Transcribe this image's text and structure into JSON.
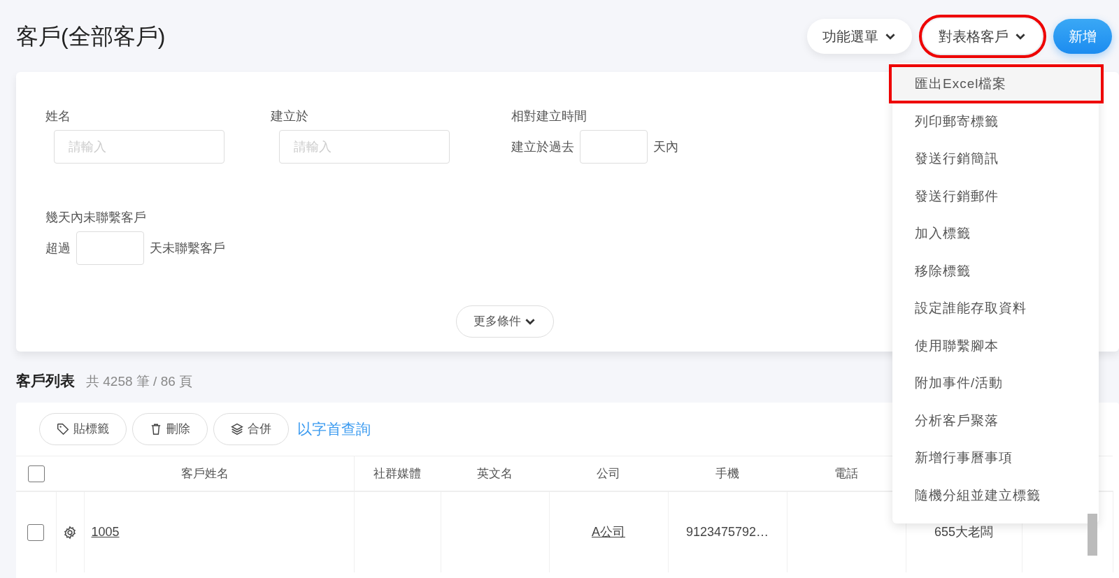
{
  "page_title": "客戶(全部客戶)",
  "header_buttons": [
    {
      "label": "功能選單",
      "kind": "dropdown",
      "highlighted": false
    },
    {
      "label": "對表格客戶",
      "kind": "dropdown",
      "highlighted": true
    },
    {
      "label": "新增",
      "kind": "primary",
      "highlighted": false
    }
  ],
  "filters": {
    "fields": [
      {
        "label": "姓名",
        "kind": "text",
        "placeholder": "請輸入"
      },
      {
        "label": "建立於",
        "kind": "text",
        "placeholder": "請輸入"
      },
      {
        "label": "相對建立時間",
        "kind": "days",
        "prefix": "建立於過去",
        "suffix": "天內"
      },
      {
        "label": "幾天內未聯繫客戶",
        "kind": "days",
        "prefix": "超過",
        "suffix": "天未聯繫客戶"
      }
    ],
    "more_button": "更多條件"
  },
  "list": {
    "title": "客戶列表",
    "summary": "共 4258 筆 / 86 頁"
  },
  "toolbar": [
    {
      "label": "貼標籤",
      "kind": "tag"
    },
    {
      "label": "刪除",
      "kind": "trash"
    },
    {
      "label": "合併",
      "kind": "layers"
    },
    {
      "label": "以字首查詢",
      "kind": "link"
    }
  ],
  "table": {
    "select_all_checked": false,
    "columns": [
      "客戶姓名",
      "社群媒體",
      "英文名",
      "公司",
      "手機",
      "電話"
    ],
    "rows": [
      {
        "checked": false,
        "cells": [
          {
            "text": "1005",
            "link": true
          },
          null,
          null,
          {
            "text": "A公司",
            "link": true
          },
          {
            "text": "9123475792…",
            "link": false
          },
          null,
          {
            "text": "655大老闆",
            "link": false
          }
        ]
      }
    ]
  },
  "dropdown_menu": [
    {
      "label": "匯出Excel檔案",
      "selected": true
    },
    {
      "label": "列印郵寄標籤",
      "selected": false
    },
    {
      "label": "發送行銷簡訊",
      "selected": false
    },
    {
      "label": "發送行銷郵件",
      "selected": false
    },
    {
      "label": "加入標籤",
      "selected": false
    },
    {
      "label": "移除標籤",
      "selected": false
    },
    {
      "label": "設定誰能存取資料",
      "selected": false
    },
    {
      "label": "使用聯繫腳本",
      "selected": false
    },
    {
      "label": "附加事件/活動",
      "selected": false
    },
    {
      "label": "分析客戶聚落",
      "selected": false
    },
    {
      "label": "新增行事曆事項",
      "selected": false
    },
    {
      "label": "隨機分組並建立標籤",
      "selected": false
    }
  ]
}
